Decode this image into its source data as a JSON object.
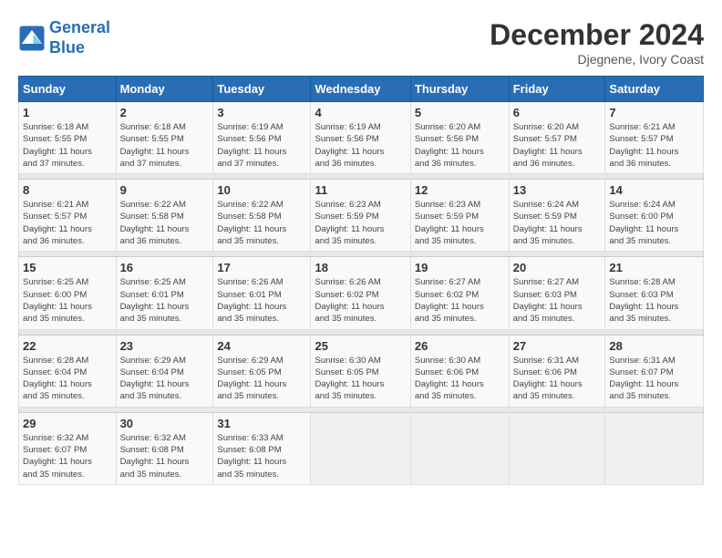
{
  "logo": {
    "line1": "General",
    "line2": "Blue"
  },
  "title": {
    "month_year": "December 2024",
    "location": "Djegnene, Ivory Coast"
  },
  "days_of_week": [
    "Sunday",
    "Monday",
    "Tuesday",
    "Wednesday",
    "Thursday",
    "Friday",
    "Saturday"
  ],
  "weeks": [
    [
      {
        "day": "1",
        "info": "Sunrise: 6:18 AM\nSunset: 5:55 PM\nDaylight: 11 hours\nand 37 minutes."
      },
      {
        "day": "2",
        "info": "Sunrise: 6:18 AM\nSunset: 5:55 PM\nDaylight: 11 hours\nand 37 minutes."
      },
      {
        "day": "3",
        "info": "Sunrise: 6:19 AM\nSunset: 5:56 PM\nDaylight: 11 hours\nand 37 minutes."
      },
      {
        "day": "4",
        "info": "Sunrise: 6:19 AM\nSunset: 5:56 PM\nDaylight: 11 hours\nand 36 minutes."
      },
      {
        "day": "5",
        "info": "Sunrise: 6:20 AM\nSunset: 5:56 PM\nDaylight: 11 hours\nand 36 minutes."
      },
      {
        "day": "6",
        "info": "Sunrise: 6:20 AM\nSunset: 5:57 PM\nDaylight: 11 hours\nand 36 minutes."
      },
      {
        "day": "7",
        "info": "Sunrise: 6:21 AM\nSunset: 5:57 PM\nDaylight: 11 hours\nand 36 minutes."
      }
    ],
    [
      {
        "day": "8",
        "info": "Sunrise: 6:21 AM\nSunset: 5:57 PM\nDaylight: 11 hours\nand 36 minutes."
      },
      {
        "day": "9",
        "info": "Sunrise: 6:22 AM\nSunset: 5:58 PM\nDaylight: 11 hours\nand 36 minutes."
      },
      {
        "day": "10",
        "info": "Sunrise: 6:22 AM\nSunset: 5:58 PM\nDaylight: 11 hours\nand 35 minutes."
      },
      {
        "day": "11",
        "info": "Sunrise: 6:23 AM\nSunset: 5:59 PM\nDaylight: 11 hours\nand 35 minutes."
      },
      {
        "day": "12",
        "info": "Sunrise: 6:23 AM\nSunset: 5:59 PM\nDaylight: 11 hours\nand 35 minutes."
      },
      {
        "day": "13",
        "info": "Sunrise: 6:24 AM\nSunset: 5:59 PM\nDaylight: 11 hours\nand 35 minutes."
      },
      {
        "day": "14",
        "info": "Sunrise: 6:24 AM\nSunset: 6:00 PM\nDaylight: 11 hours\nand 35 minutes."
      }
    ],
    [
      {
        "day": "15",
        "info": "Sunrise: 6:25 AM\nSunset: 6:00 PM\nDaylight: 11 hours\nand 35 minutes."
      },
      {
        "day": "16",
        "info": "Sunrise: 6:25 AM\nSunset: 6:01 PM\nDaylight: 11 hours\nand 35 minutes."
      },
      {
        "day": "17",
        "info": "Sunrise: 6:26 AM\nSunset: 6:01 PM\nDaylight: 11 hours\nand 35 minutes."
      },
      {
        "day": "18",
        "info": "Sunrise: 6:26 AM\nSunset: 6:02 PM\nDaylight: 11 hours\nand 35 minutes."
      },
      {
        "day": "19",
        "info": "Sunrise: 6:27 AM\nSunset: 6:02 PM\nDaylight: 11 hours\nand 35 minutes."
      },
      {
        "day": "20",
        "info": "Sunrise: 6:27 AM\nSunset: 6:03 PM\nDaylight: 11 hours\nand 35 minutes."
      },
      {
        "day": "21",
        "info": "Sunrise: 6:28 AM\nSunset: 6:03 PM\nDaylight: 11 hours\nand 35 minutes."
      }
    ],
    [
      {
        "day": "22",
        "info": "Sunrise: 6:28 AM\nSunset: 6:04 PM\nDaylight: 11 hours\nand 35 minutes."
      },
      {
        "day": "23",
        "info": "Sunrise: 6:29 AM\nSunset: 6:04 PM\nDaylight: 11 hours\nand 35 minutes."
      },
      {
        "day": "24",
        "info": "Sunrise: 6:29 AM\nSunset: 6:05 PM\nDaylight: 11 hours\nand 35 minutes."
      },
      {
        "day": "25",
        "info": "Sunrise: 6:30 AM\nSunset: 6:05 PM\nDaylight: 11 hours\nand 35 minutes."
      },
      {
        "day": "26",
        "info": "Sunrise: 6:30 AM\nSunset: 6:06 PM\nDaylight: 11 hours\nand 35 minutes."
      },
      {
        "day": "27",
        "info": "Sunrise: 6:31 AM\nSunset: 6:06 PM\nDaylight: 11 hours\nand 35 minutes."
      },
      {
        "day": "28",
        "info": "Sunrise: 6:31 AM\nSunset: 6:07 PM\nDaylight: 11 hours\nand 35 minutes."
      }
    ],
    [
      {
        "day": "29",
        "info": "Sunrise: 6:32 AM\nSunset: 6:07 PM\nDaylight: 11 hours\nand 35 minutes."
      },
      {
        "day": "30",
        "info": "Sunrise: 6:32 AM\nSunset: 6:08 PM\nDaylight: 11 hours\nand 35 minutes."
      },
      {
        "day": "31",
        "info": "Sunrise: 6:33 AM\nSunset: 6:08 PM\nDaylight: 11 hours\nand 35 minutes."
      },
      null,
      null,
      null,
      null
    ]
  ]
}
